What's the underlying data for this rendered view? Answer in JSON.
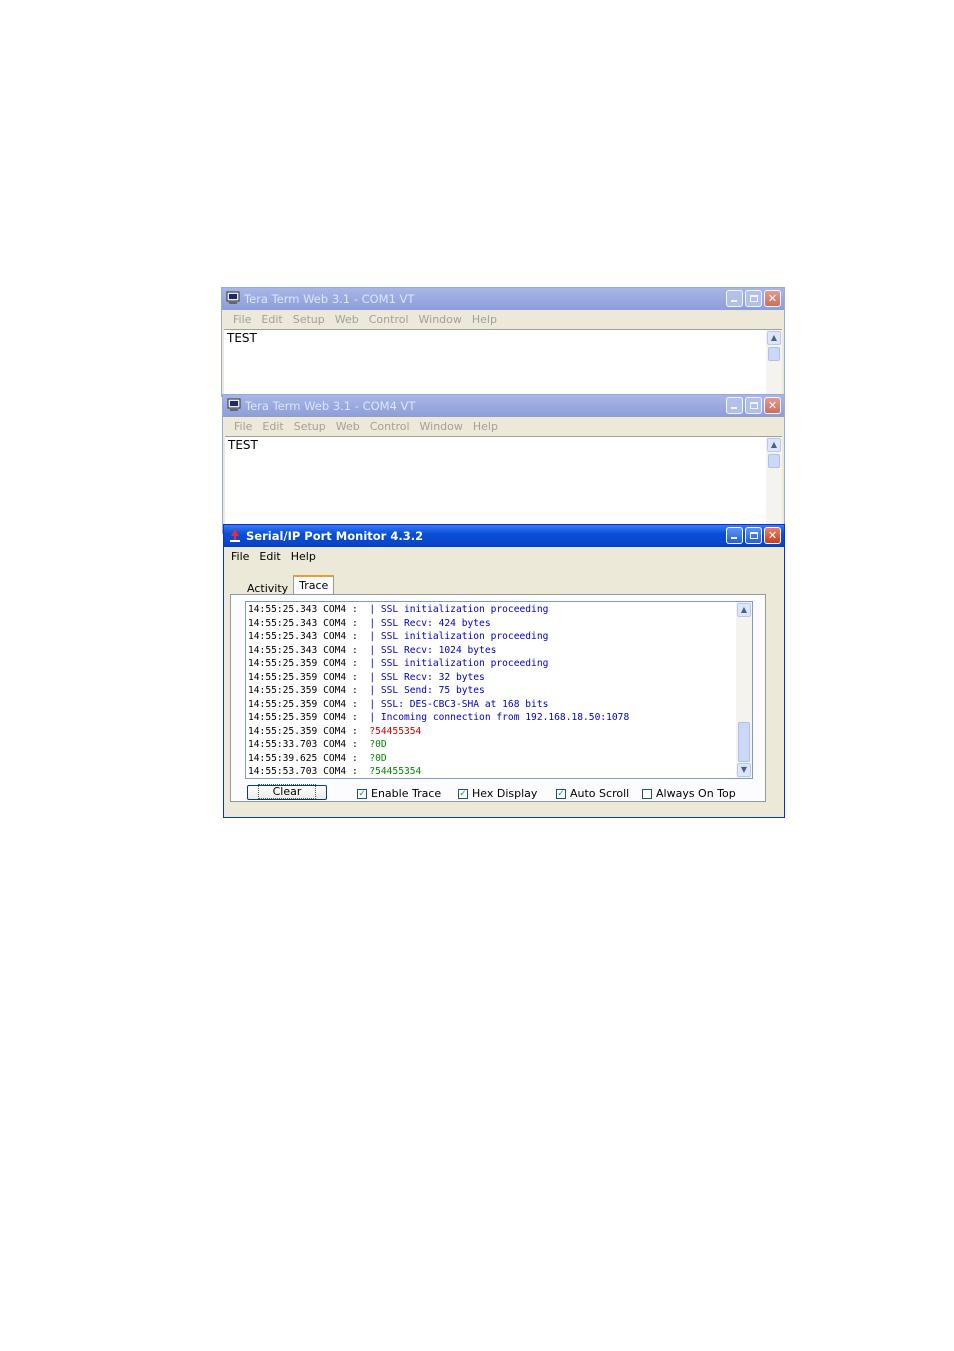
{
  "tera1": {
    "title": "Tera Term Web 3.1 - COM1 VT",
    "menu": [
      "File",
      "Edit",
      "Setup",
      "Web",
      "Control",
      "Window",
      "Help"
    ],
    "content": "TEST"
  },
  "tera2": {
    "title": "Tera Term Web 3.1 - COM4 VT",
    "menu": [
      "File",
      "Edit",
      "Setup",
      "Web",
      "Control",
      "Window",
      "Help"
    ],
    "content": "TEST"
  },
  "monitor": {
    "title": "Serial/IP Port Monitor 4.3.2",
    "menu": [
      "File",
      "Edit",
      "Help"
    ],
    "tabs": [
      "Activity",
      "Trace"
    ],
    "selected_tab": "Trace",
    "trace": [
      {
        "time": "14:55:25.343 COM4 :",
        "msg": "| SSL initialization proceeding",
        "color": "#0000c8"
      },
      {
        "time": "14:55:25.343 COM4 :",
        "msg": "| SSL Recv: 424 bytes",
        "color": "#0000c8"
      },
      {
        "time": "14:55:25.343 COM4 :",
        "msg": "| SSL initialization proceeding",
        "color": "#0000c8"
      },
      {
        "time": "14:55:25.343 COM4 :",
        "msg": "| SSL Recv: 1024 bytes",
        "color": "#0000c8"
      },
      {
        "time": "14:55:25.359 COM4 :",
        "msg": "| SSL initialization proceeding",
        "color": "#0000c8"
      },
      {
        "time": "14:55:25.359 COM4 :",
        "msg": "| SSL Recv: 32 bytes",
        "color": "#0000c8"
      },
      {
        "time": "14:55:25.359 COM4 :",
        "msg": "| SSL Send: 75 bytes",
        "color": "#0000c8"
      },
      {
        "time": "14:55:25.359 COM4 :",
        "msg": "| SSL: DES-CBC3-SHA at 168 bits",
        "color": "#0000c8"
      },
      {
        "time": "14:55:25.359 COM4 :",
        "msg": "| Incoming connection from 192.168.18.50:1078",
        "color": "#0000c8"
      },
      {
        "time": "14:55:25.359 COM4 :",
        "msg": "?54455354",
        "color": "#d00000"
      },
      {
        "time": "14:55:33.703 COM4 :",
        "msg": "?0D",
        "color": "#008800"
      },
      {
        "time": "14:55:39.625 COM4 :",
        "msg": "?0D",
        "color": "#008800"
      },
      {
        "time": "14:55:53.703 COM4 :",
        "msg": "?54455354",
        "color": "#008800"
      }
    ],
    "clear_label": "Clear",
    "checkboxes": [
      {
        "label": "Enable Trace",
        "checked": true
      },
      {
        "label": "Hex Display",
        "checked": true
      },
      {
        "label": "Auto Scroll",
        "checked": true
      },
      {
        "label": "Always On Top",
        "checked": false
      }
    ]
  }
}
